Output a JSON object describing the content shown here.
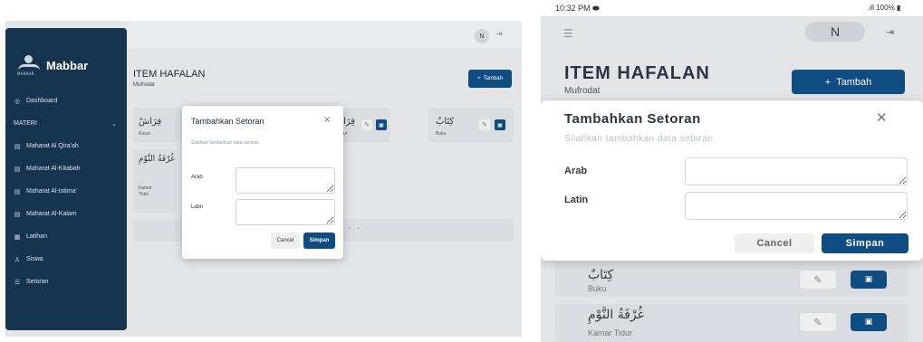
{
  "desktop": {
    "brand": {
      "name": "Mabbar",
      "tagline": "MABBAR"
    },
    "avatar_initial": "N",
    "sidebar": {
      "dashboard": "Dashboard",
      "section_label": "MATERI",
      "items": [
        {
          "label": "Maharat Al Qira'ah"
        },
        {
          "label": "Maharat Al-Kitabah"
        },
        {
          "label": "Maharat Al-Istima'"
        },
        {
          "label": "Maharat Al-Kalam"
        }
      ],
      "latihan": "Latihan",
      "siswa": "Siswa",
      "setoran": "Setoran"
    },
    "page": {
      "title": "ITEM HAFALAN",
      "subtitle": "Mufrodat",
      "add_button": "Tambah"
    },
    "cards": [
      {
        "arabic": "فِرَاشٌ",
        "latin": "Kasur"
      },
      {
        "arabic": "فِرَا",
        "latin": "ur"
      },
      {
        "arabic": "كِتَابٌ",
        "latin": "Buku"
      },
      {
        "arabic": "غُرْفَةُ النَّوْمِ",
        "latin_lines": [
          "Kamar",
          "Tidur"
        ]
      }
    ],
    "modal": {
      "title": "Tambahkan Setoran",
      "subtitle": "Silahkan tambahkan data setoran",
      "arab_label": "Arab",
      "latin_label": "Latin",
      "cancel": "Cancel",
      "submit": "Simpan"
    }
  },
  "mobile": {
    "status": {
      "time": "10:32 PM",
      "battery": "100%"
    },
    "avatar_initial": "N",
    "page": {
      "title": "ITEM HAFALAN",
      "subtitle": "Mufrodat",
      "add_button": "Tambah"
    },
    "cards": [
      {
        "arabic": "كِتَابٌ",
        "latin": "Buku"
      },
      {
        "arabic": "غُرْفَةُ النَّوْمِ",
        "latin": "Kamar Tidur"
      }
    ],
    "modal": {
      "title": "Tambahkan Setoran",
      "subtitle": "Silahkan tambahkan data setoran",
      "arab_label": "Arab",
      "latin_label": "Latin",
      "cancel": "Cancel",
      "submit": "Simpan"
    }
  },
  "colors": {
    "primary": "#0f4c81",
    "sidebar": "#17344f",
    "backdrop": "#e3e5e8"
  }
}
